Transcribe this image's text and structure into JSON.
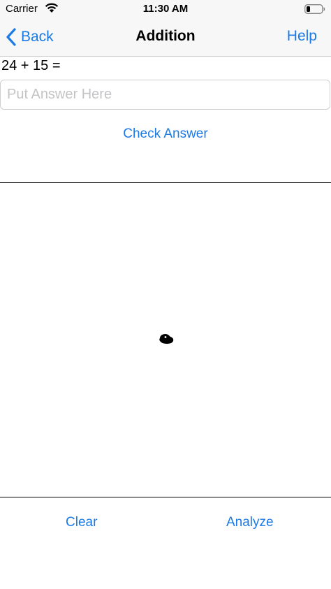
{
  "status_bar": {
    "carrier": "Carrier",
    "time": "11:30 AM",
    "wifi_icon": "wifi-icon",
    "battery_icon": "battery-icon"
  },
  "nav": {
    "back_label": "Back",
    "back_icon": "chevron-left-icon",
    "title": "Addition",
    "help_label": "Help"
  },
  "problem": {
    "question": "24 + 15 ="
  },
  "answer": {
    "value": "",
    "placeholder": "Put Answer Here"
  },
  "actions": {
    "check_label": "Check Answer",
    "clear_label": "Clear",
    "analyze_label": "Analyze"
  },
  "colors": {
    "accent": "#1a7ae6",
    "bar_background": "#f7f7f7",
    "placeholder": "#c4c4c7",
    "ink": "#000000"
  }
}
